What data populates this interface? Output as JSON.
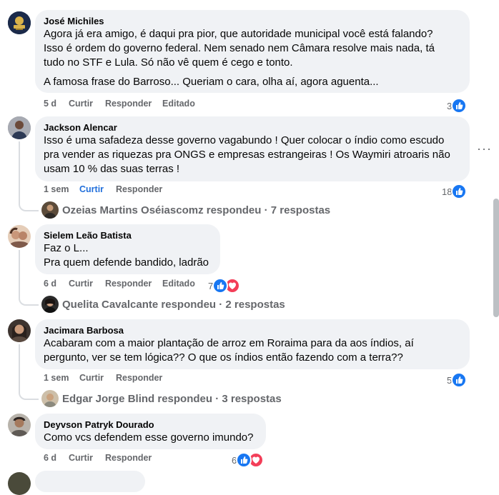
{
  "comments": [
    {
      "author": "José Michiles",
      "text1": "Agora já era amigo, é daqui pra pior, que autoridade municipal você está falando?",
      "text2": "Isso é ordem do governo federal. Nem senado nem Câmara resolve mais nada, tá",
      "text3": "tudo no STF e Lula. Só não vê quem é cego e tonto.",
      "text4": "A famosa frase do Barroso... Queriam o cara, olha aí, agora aguenta...",
      "time": "5 d",
      "like": "Curtir",
      "reply": "Responder",
      "edited": "Editado",
      "reactions": "3"
    },
    {
      "author": "Jackson Alencar",
      "text1": "Isso é uma safadeza desse governo vagabundo ! Quer colocar o índio como escudo",
      "text2": "pra vender as riquezas pra ONGS e empresas estrangeiras ! Os Waymiri atroaris não",
      "text3": "usam 10 % das suas terras !",
      "time": "1 sem",
      "like": "Curtir",
      "reply": "Responder",
      "reactions": "18",
      "replies": "Ozeias Martins Oséiascomz respondeu · 7 respostas"
    },
    {
      "author": "Sielem Leão Batista",
      "text1": "Faz o L...",
      "text2": "Pra quem defende bandido, ladrão",
      "time": "6 d",
      "like": "Curtir",
      "reply": "Responder",
      "edited": "Editado",
      "reactions": "7",
      "replies": "Quelita Cavalcante respondeu · 2 respostas"
    },
    {
      "author": "Jacimara Barbosa",
      "text1": "Acabaram com a maior plantação de arroz em Roraima para da aos índios, aí",
      "text2": "pergunto, ver se tem lógica?? O que os índios então fazendo com a terra??",
      "time": "1 sem",
      "like": "Curtir",
      "reply": "Responder",
      "reactions": "5",
      "replies": "Edgar Jorge Blind respondeu · 3 respostas"
    },
    {
      "author": "Deyvson Patryk Dourado",
      "text1": "Como vcs defendem esse governo imundo?",
      "time": "6 d",
      "like": "Curtir",
      "reply": "Responder",
      "reactions": "6"
    }
  ],
  "more_menu": "···",
  "colors": {
    "like_blue": "#1877f2",
    "love_red": "#f33e58",
    "bubble": "#f0f2f5",
    "meta": "#65676b",
    "active": "#216fdb"
  },
  "icons": [
    "like-icon",
    "love-icon",
    "more-options-icon"
  ]
}
